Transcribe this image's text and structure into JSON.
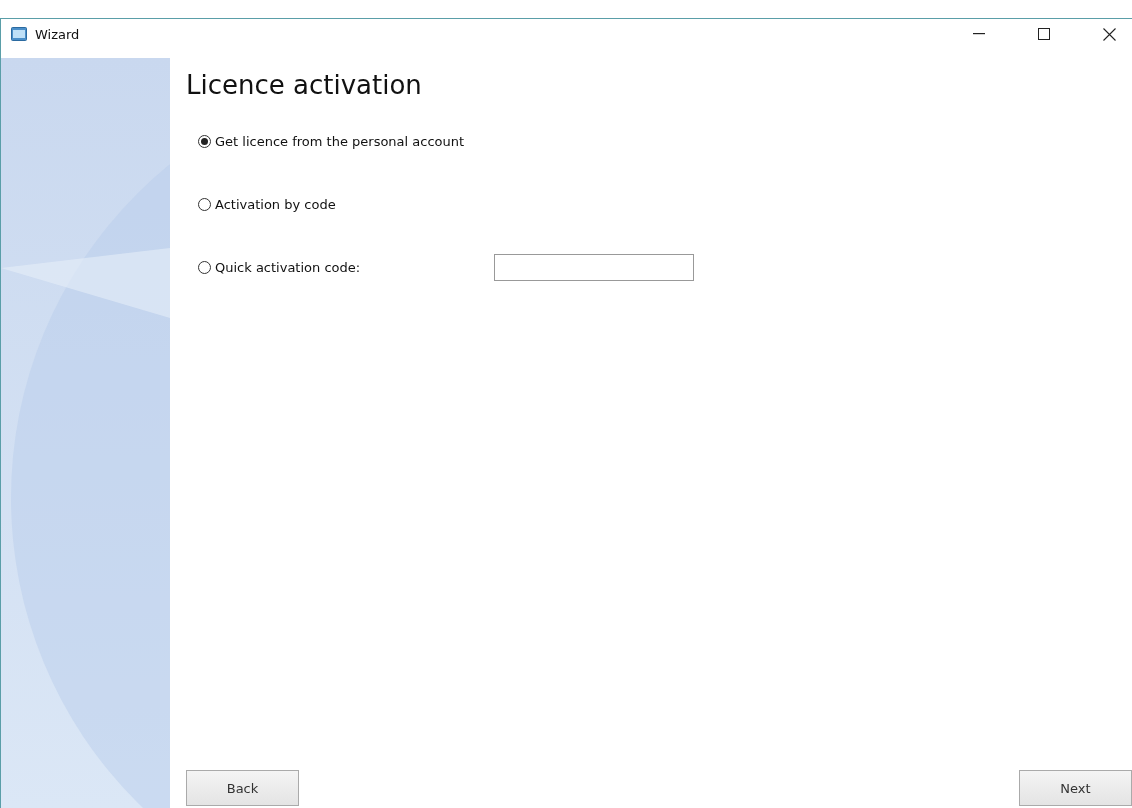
{
  "window": {
    "title": "Wizard"
  },
  "heading": "Licence activation",
  "options": [
    {
      "label": "Get licence from the personal account",
      "selected": true,
      "kind": "plain"
    },
    {
      "label": "Activation by code",
      "selected": false,
      "kind": "plain"
    },
    {
      "label": "Quick activation code:",
      "selected": false,
      "kind": "with-field"
    }
  ],
  "buttons": [
    "Back",
    "Next"
  ]
}
